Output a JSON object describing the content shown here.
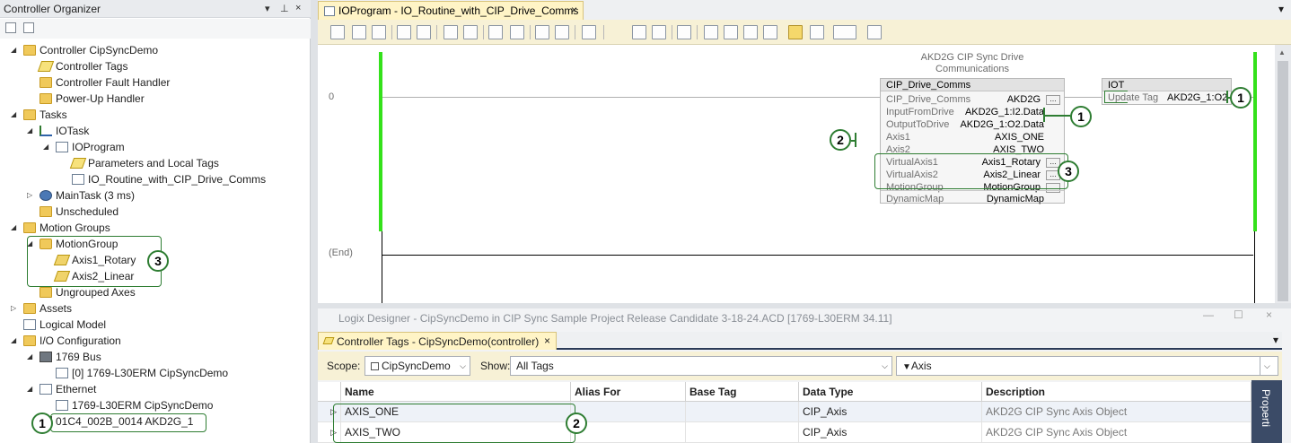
{
  "organizer": {
    "title": "Controller Organizer",
    "tree": [
      {
        "label": "Controller CipSyncDemo",
        "level": 0,
        "expander": "◢",
        "icon": "folder-icon"
      },
      {
        "label": "Controller Tags",
        "level": 1,
        "expander": "",
        "icon": "tag-icon"
      },
      {
        "label": "Controller Fault Handler",
        "level": 1,
        "expander": "",
        "icon": "folder-icon"
      },
      {
        "label": "Power-Up Handler",
        "level": 1,
        "expander": "",
        "icon": "folder-icon"
      },
      {
        "label": "Tasks",
        "level": 0,
        "expander": "◢",
        "icon": "folder-icon"
      },
      {
        "label": "IOTask",
        "level": 1,
        "expander": "◢",
        "icon": "task-icon"
      },
      {
        "label": "IOProgram",
        "level": 2,
        "expander": "◢",
        "icon": "program-icon"
      },
      {
        "label": "Parameters and Local Tags",
        "level": 3,
        "expander": "",
        "icon": "tag-icon"
      },
      {
        "label": "IO_Routine_with_CIP_Drive_Comms",
        "level": 3,
        "expander": "",
        "icon": "routine-icon"
      },
      {
        "label": "MainTask (3 ms)",
        "level": 1,
        "expander": "▷",
        "icon": "clock-task-icon"
      },
      {
        "label": "Unscheduled",
        "level": 1,
        "expander": "",
        "icon": "folder-icon"
      },
      {
        "label": "Motion Groups",
        "level": 0,
        "expander": "◢",
        "icon": "folder-icon"
      },
      {
        "label": "MotionGroup",
        "level": 1,
        "expander": "◢",
        "icon": "motion-group-icon"
      },
      {
        "label": "Axis1_Rotary",
        "level": 2,
        "expander": "",
        "icon": "axis-icon"
      },
      {
        "label": "Axis2_Linear",
        "level": 2,
        "expander": "",
        "icon": "axis-icon"
      },
      {
        "label": "Ungrouped Axes",
        "level": 1,
        "expander": "",
        "icon": "folder-icon"
      },
      {
        "label": "Assets",
        "level": 0,
        "expander": "▷",
        "icon": "folder-icon"
      },
      {
        "label": "Logical Model",
        "level": 0,
        "expander": "",
        "icon": "logical-model-icon"
      },
      {
        "label": "I/O Configuration",
        "level": 0,
        "expander": "◢",
        "icon": "folder-icon"
      },
      {
        "label": "1769 Bus",
        "level": 1,
        "expander": "◢",
        "icon": "bus-icon"
      },
      {
        "label": "[0] 1769-L30ERM CipSyncDemo",
        "level": 2,
        "expander": "",
        "icon": "controller-icon"
      },
      {
        "label": "Ethernet",
        "level": 1,
        "expander": "◢",
        "icon": "network-icon"
      },
      {
        "label": "1769-L30ERM CipSyncDemo",
        "level": 2,
        "expander": "",
        "icon": "controller-icon"
      },
      {
        "label": "01C4_002B_0014 AKD2G_1",
        "level": 1,
        "expander": "",
        "icon": "drive-icon"
      }
    ]
  },
  "doc": {
    "tab_label": "IOProgram - IO_Routine_with_CIP_Drive_Comms",
    "close": "×",
    "tab_menu": "▾"
  },
  "ladder": {
    "rung0_number": "0",
    "end_label": "(End)",
    "aoi_caption_line1": "AKD2G CIP Sync Drive",
    "aoi_caption_line2": "Communications",
    "aoi": {
      "name": "CIP_Drive_Comms",
      "rows": [
        {
          "label": "CIP_Drive_Comms",
          "value": "AKD2G",
          "button": true
        },
        {
          "label": "InputFromDrive",
          "value": "AKD2G_1:I2.Data",
          "button": false
        },
        {
          "label": "OutputToDrive",
          "value": "AKD2G_1:O2.Data",
          "button": false
        },
        {
          "label": "Axis1",
          "value": "AXIS_ONE",
          "button": false
        },
        {
          "label": "Axis2",
          "value": "AXIS_TWO",
          "button": false
        },
        {
          "label": "VirtualAxis1",
          "value": "Axis1_Rotary",
          "button": true
        },
        {
          "label": "VirtualAxis2",
          "value": "Axis2_Linear",
          "button": true
        },
        {
          "label": "MotionGroup",
          "value": "MotionGroup",
          "button": true
        },
        {
          "label": "DynamicMap",
          "value": "DynamicMap",
          "button": false
        }
      ]
    },
    "iot": {
      "name": "IOT",
      "label": "Update Tag",
      "value": "AKD2G_1:O2"
    },
    "more_button": "..."
  },
  "callouts": {
    "one": "1",
    "two": "2",
    "three": "3"
  },
  "tags_panel": {
    "window_title": "Logix Designer - CipSyncDemo in CIP Sync Sample Project Release Candidate 3-18-24.ACD [1769-L30ERM 34.11]",
    "win_min": "—",
    "win_max": "☐",
    "win_close": "×",
    "tab_label": "Controller Tags - CipSyncDemo(controller)",
    "tab_close": "×",
    "scope_label": "Scope:",
    "scope_value": "CipSyncDemo",
    "show_label": "Show:",
    "show_value": "All Tags",
    "filter_value": "Axis",
    "columns": [
      "Name",
      "Alias For",
      "Base Tag",
      "Data Type",
      "Description"
    ],
    "rows": [
      {
        "expander": "▷",
        "name": "AXIS_ONE",
        "alias": "",
        "base": "",
        "type": "CIP_Axis",
        "desc": "AKD2G CIP Sync Axis Object"
      },
      {
        "expander": "▷",
        "name": "AXIS_TWO",
        "alias": "",
        "base": "",
        "type": "CIP_Axis",
        "desc": "AKD2G CIP Sync Axis Object"
      }
    ],
    "properties_label": "Properti"
  }
}
